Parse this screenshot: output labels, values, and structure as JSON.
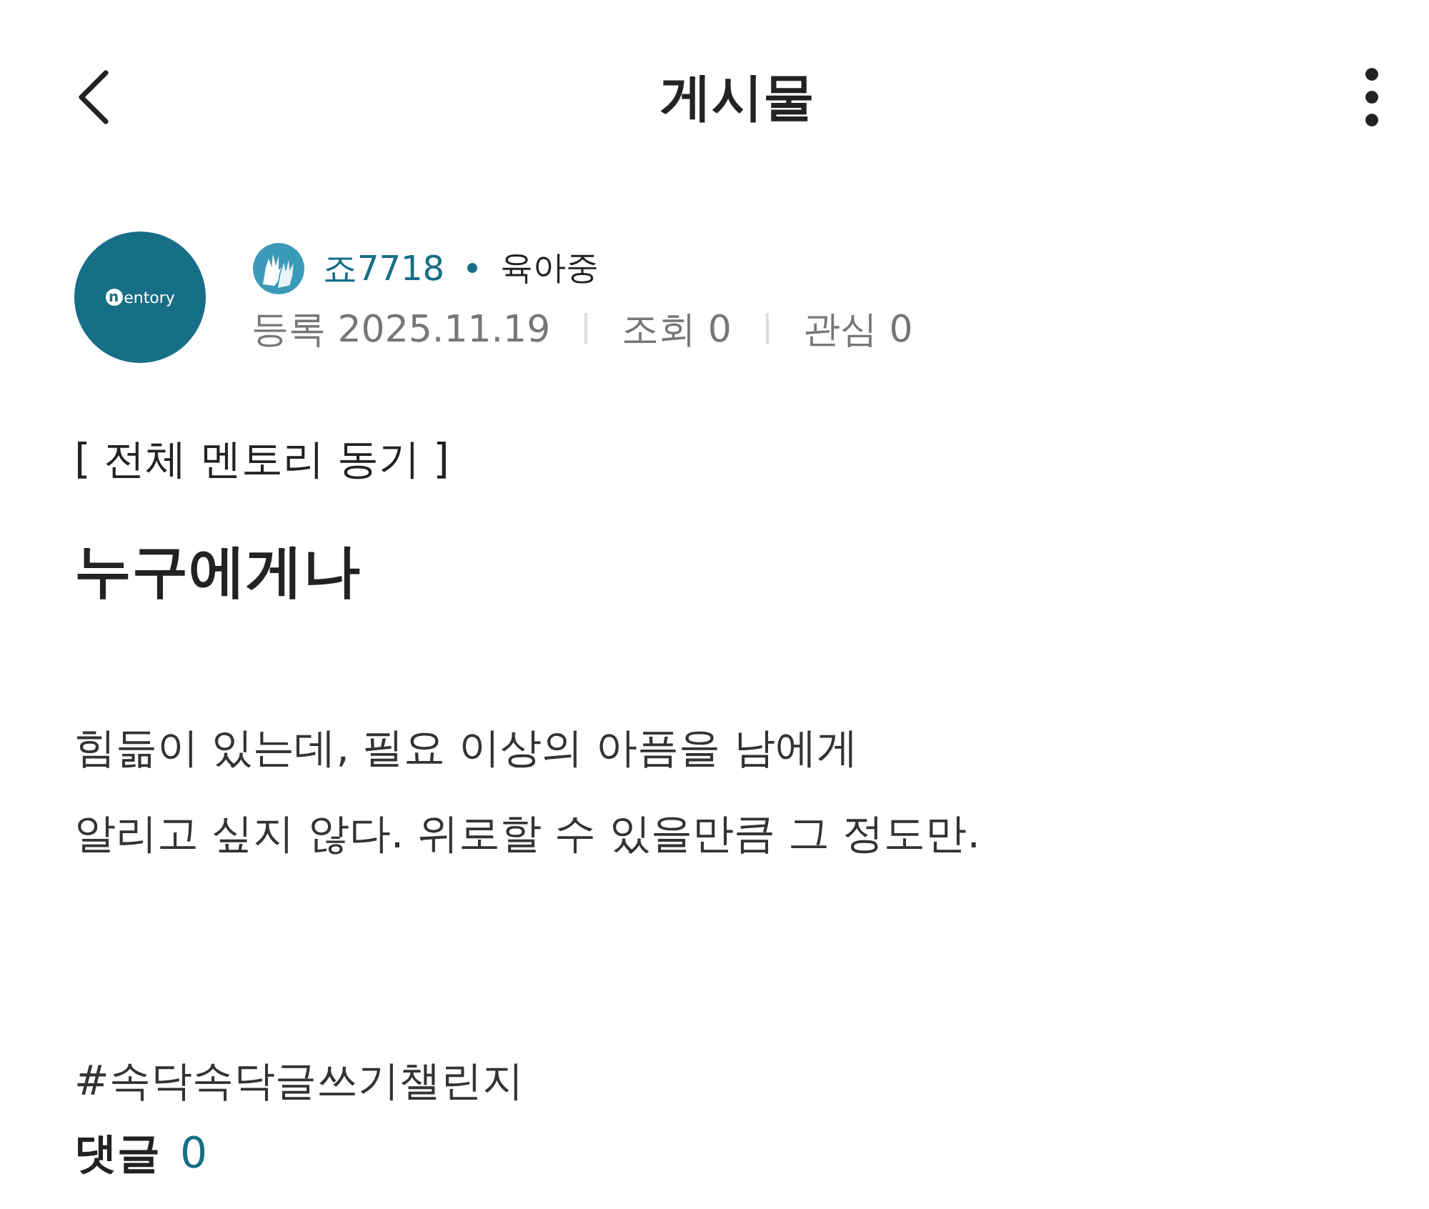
{
  "header": {
    "title": "게시물"
  },
  "author": {
    "avatar_logo": {
      "mark": "n",
      "text": "entory"
    },
    "nickname": "죠7718",
    "status": "육아중"
  },
  "meta": [
    {
      "label": "등록",
      "value": "2025.11.19"
    },
    {
      "label": "조회",
      "value": "0"
    },
    {
      "label": "관심",
      "value": "0"
    }
  ],
  "post": {
    "category": "[ 전체 멘토리 동기 ]",
    "title": "누구에게나",
    "body": [
      "힘듦이 있는데, 필요 이상의 아픔을 남에게",
      "알리고 싶지 않다. 위로할 수 있을만큼 그 정도만."
    ],
    "hashtag": "#속닥속닥글쓰기챌린지"
  },
  "comments": {
    "label": "댓글",
    "count": "0"
  }
}
